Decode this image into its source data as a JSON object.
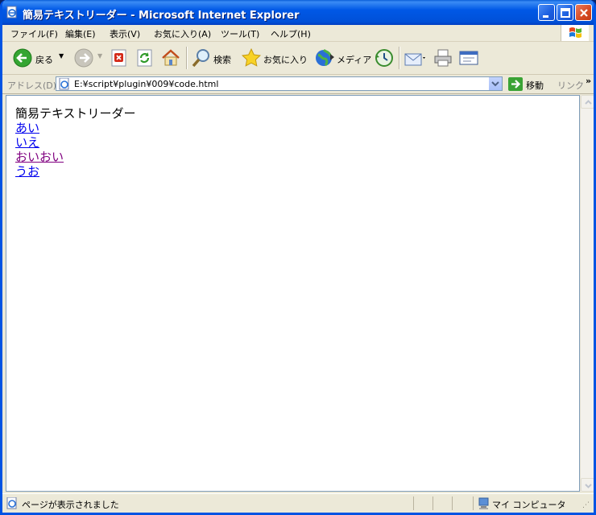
{
  "window": {
    "title": "簡易テキストリーダー - Microsoft Internet Explorer"
  },
  "menu": {
    "items": [
      "ファイル(F)",
      "編集(E)",
      "表示(V)",
      "お気に入り(A)",
      "ツール(T)",
      "ヘルプ(H)"
    ]
  },
  "toolbar": {
    "back_label": "戻る",
    "search_label": "検索",
    "favorites_label": "お気に入り",
    "media_label": "メディア"
  },
  "address": {
    "label": "アドレス(D)",
    "url": "E:¥script¥plugin¥009¥code.html",
    "go_label": "移動",
    "links_label": "リンク"
  },
  "page": {
    "heading": "簡易テキストリーダー",
    "links": [
      {
        "text": "あい",
        "visited": false
      },
      {
        "text": "いえ",
        "visited": false
      },
      {
        "text": "おいおい",
        "visited": true
      },
      {
        "text": "うお",
        "visited": false
      }
    ]
  },
  "status": {
    "text": "ページが表示されました",
    "zone": "マイ コンピュータ"
  }
}
